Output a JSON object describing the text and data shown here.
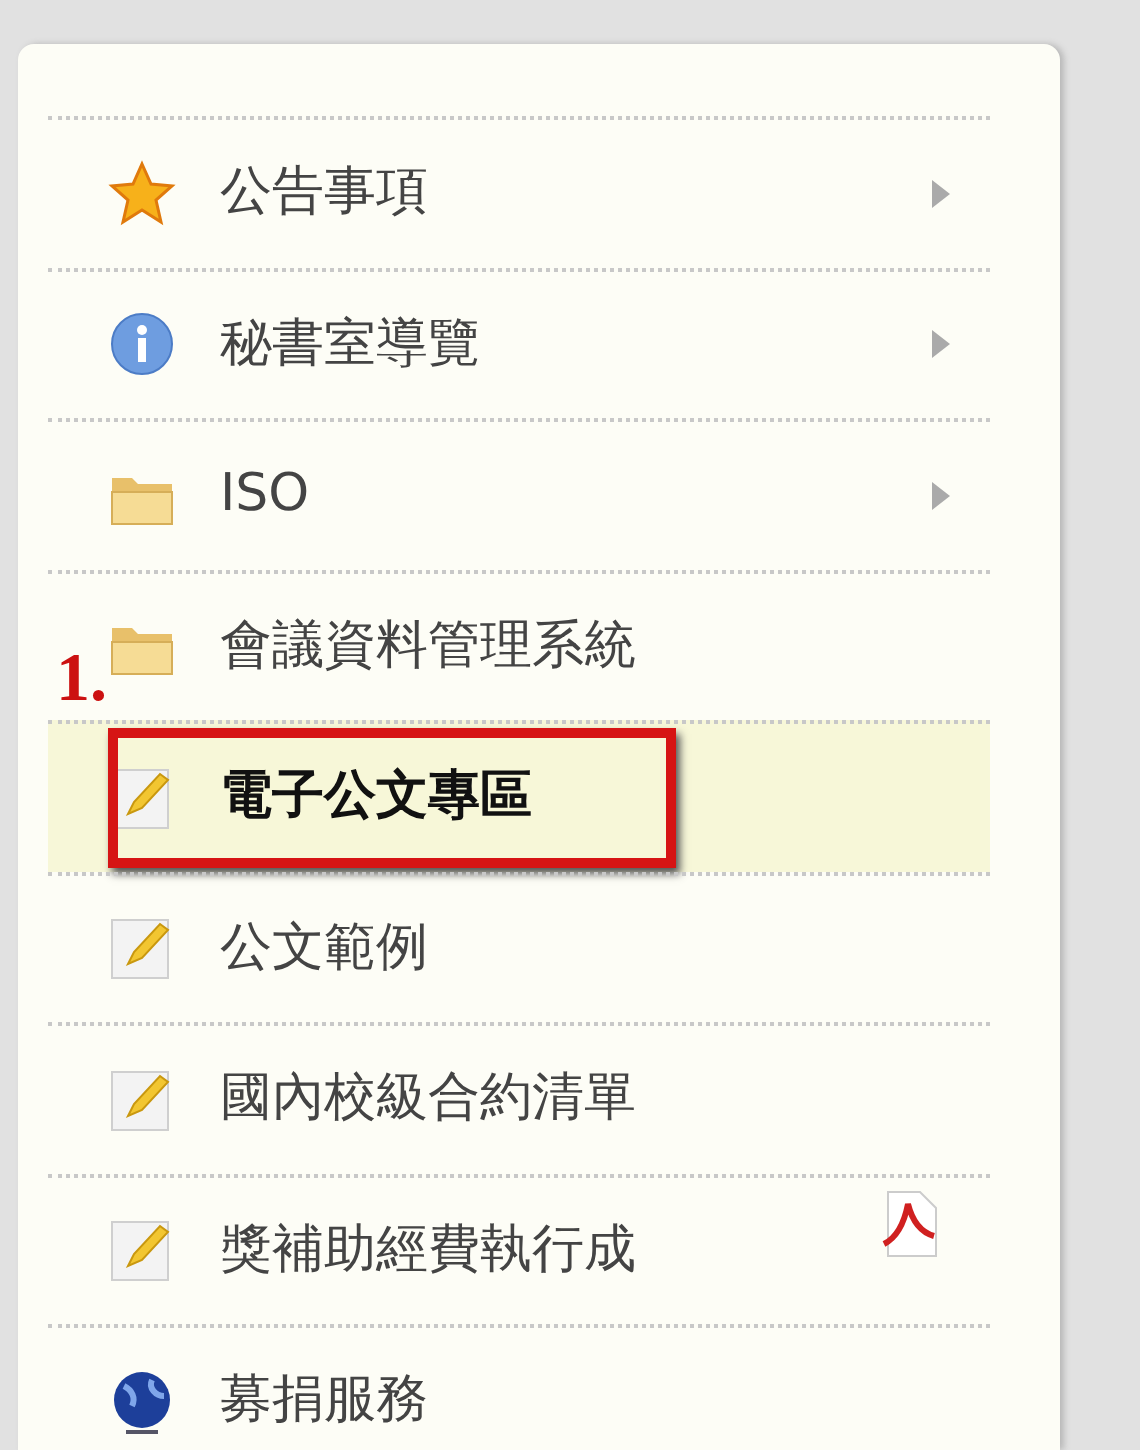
{
  "menu": {
    "items": [
      {
        "label": "公告事項",
        "kind": "star",
        "submenu": true,
        "selected": false
      },
      {
        "label": "秘書室導覽",
        "kind": "info",
        "submenu": true,
        "selected": false
      },
      {
        "label": "ISO",
        "kind": "folder",
        "submenu": true,
        "selected": false
      },
      {
        "label": "會議資料管理系統",
        "kind": "folder",
        "submenu": false,
        "selected": false,
        "step_label": "1."
      },
      {
        "label": "電子公文專區",
        "kind": "pencil",
        "submenu": false,
        "selected": true,
        "boxed": true
      },
      {
        "label": "公文範例",
        "kind": "pencil",
        "submenu": false,
        "selected": false
      },
      {
        "label": "國內校級合約清單",
        "kind": "pencil",
        "submenu": false,
        "selected": false
      },
      {
        "label": "獎補助經費執行成",
        "kind": "pencil",
        "submenu": false,
        "selected": false,
        "pdf": true
      },
      {
        "label": "募捐服務",
        "kind": "globe",
        "submenu": false,
        "selected": false
      }
    ]
  }
}
